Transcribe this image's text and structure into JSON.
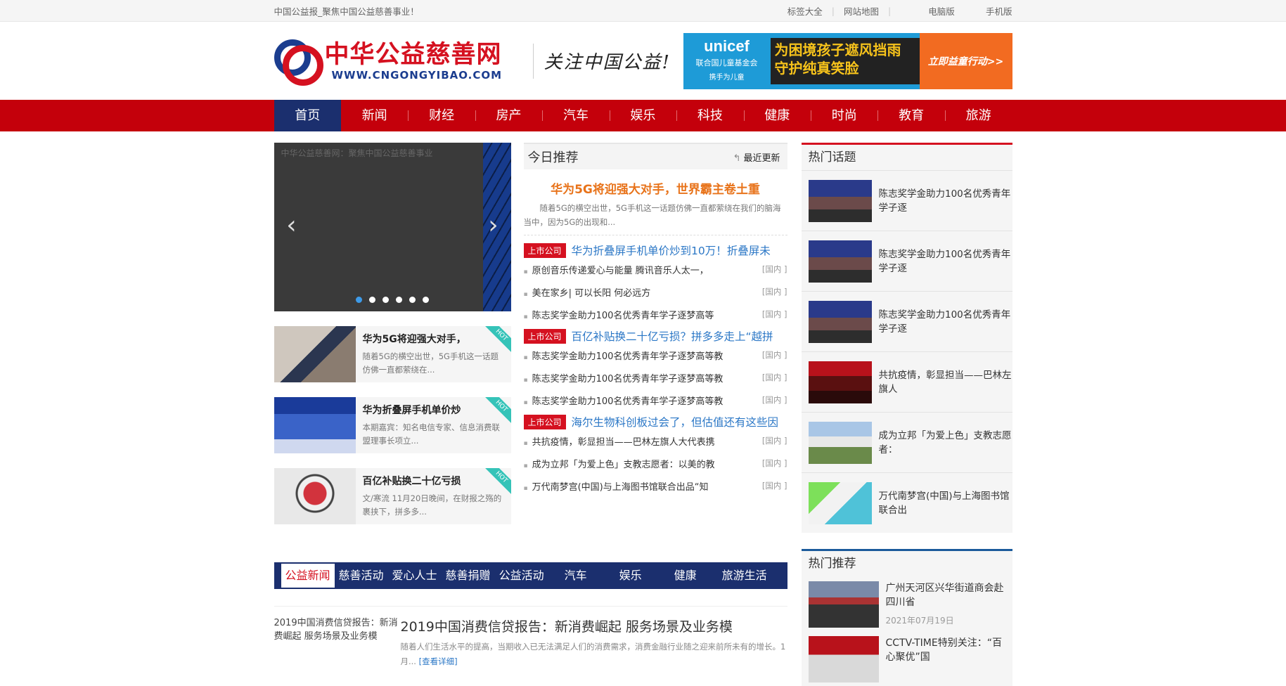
{
  "topbar": {
    "tagline": "中国公益报_聚焦中国公益慈善事业！",
    "links": [
      "标签大全",
      "网站地图",
      "电脑版",
      "手机版"
    ]
  },
  "header": {
    "logo_cn": "中华公益慈善网",
    "logo_en": "WWW.CNGONGYIBAO.COM",
    "slogan": "关注中国公益!",
    "banner": {
      "brand": "unicef",
      "org": "联合国儿童基金会",
      "motto": "携手为儿童",
      "line1": "为困境孩子遮风挡雨",
      "line2": "守护纯真笑脸",
      "cta": "立即益童行动>>"
    }
  },
  "nav": [
    "首页",
    "新闻",
    "财经",
    "房产",
    "汽车",
    "娱乐",
    "科技",
    "健康",
    "时尚",
    "教育",
    "旅游"
  ],
  "slider": {
    "alt_text": "中华公益慈善网：聚焦中国公益慈善事业",
    "dots": 6,
    "active_dot": 0
  },
  "hot_cards": [
    {
      "title": "华为5G将迎强大对手，",
      "desc": "随着5G的横空出世，5G手机这一话题仿佛一直都萦绕在...",
      "badge": "HOT"
    },
    {
      "title": "华为折叠屏手机单价炒",
      "desc": "本期嘉宾：知名电信专家、信息消费联盟理事长项立...",
      "badge": "HOT"
    },
    {
      "title": "百亿补贴换二十亿亏损",
      "desc": "文/寒流 11月20日晚间，在财报之殇的裹挟下，拼多多...",
      "badge": "HOT"
    }
  ],
  "today": {
    "title": "今日推荐",
    "more": "最近更新",
    "headline": "华为5G将迎强大对手，世界霸主卷土重",
    "headline_desc": "随着5G的横空出世，5G手机这一话题仿佛一直都萦绕在我们的脑海当中，因为5G的出现和...",
    "groups": [
      {
        "tag": "上市公司",
        "lead": "华为折叠屏手机单价炒到10万！折叠屏未",
        "items": [
          {
            "title": "原创音乐传递爱心与能量 腾讯音乐人太一，",
            "cat": "[国内 ]"
          },
          {
            "title": "美在家乡| 可以长阳 何必远方",
            "cat": "[国内 ]"
          },
          {
            "title": "陈志奖学金助力100名优秀青年学子逐梦高等",
            "cat": "[国内 ]"
          }
        ]
      },
      {
        "tag": "上市公司",
        "lead": "百亿补贴换二十亿亏损？拼多多走上“越拼",
        "items": [
          {
            "title": "陈志奖学金助力100名优秀青年学子逐梦高等教",
            "cat": "[国内 ]"
          },
          {
            "title": "陈志奖学金助力100名优秀青年学子逐梦高等教",
            "cat": "[国内 ]"
          },
          {
            "title": "陈志奖学金助力100名优秀青年学子逐梦高等教",
            "cat": "[国内 ]"
          }
        ]
      },
      {
        "tag": "上市公司",
        "lead": "海尔生物科创板过会了，但估值还有这些因",
        "items": [
          {
            "title": "共抗疫情，彰显担当——巴林左旗人大代表携",
            "cat": "[国内 ]"
          },
          {
            "title": "成为立邦「为爱上色」支教志愿者：以美的教",
            "cat": "[国内 ]"
          },
          {
            "title": "万代南梦宫(中国)与上海图书馆联合出品“知",
            "cat": "[国内 ]"
          }
        ]
      }
    ]
  },
  "hot_topics": {
    "title": "热门话题",
    "items": [
      {
        "text": "陈志奖学金助力100名优秀青年学子逐"
      },
      {
        "text": "陈志奖学金助力100名优秀青年学子逐"
      },
      {
        "text": "陈志奖学金助力100名优秀青年学子逐"
      },
      {
        "text": "共抗疫情，彰显担当——巴林左旗人"
      },
      {
        "text": "成为立邦「为爱上色」支教志愿者："
      },
      {
        "text": "万代南梦宫(中国)与上海图书馆联合出"
      }
    ]
  },
  "hot_rec": {
    "title": "热门推荐",
    "items": [
      {
        "text": "广州天河区兴华街道商会赴四川省",
        "date": "2021年07月19日"
      },
      {
        "text": "CCTV-TIME特别关注：“百心聚优”国",
        "date": ""
      }
    ]
  },
  "tabs": [
    "公益新闻",
    "慈善活动",
    "爱心人士",
    "慈善捐赠",
    "公益活动",
    "汽车",
    "娱乐",
    "健康",
    "旅游生活"
  ],
  "article": {
    "img_alt": "2019中国消费信贷报告：新消费崛起 服务场景及业务模",
    "title": "2019中国消费信贷报告：新消费崛起 服务场景及业务模",
    "desc": "随着人们生活水平的提高，当期收入已无法满足人们的消费需求，消费金融行业随之迎来前所未有的增长。1月...",
    "more": "[查看详细]"
  },
  "colors": {
    "nav_red": "#c4000b",
    "nav_active": "#1b2f6e",
    "tag_red": "#d51120",
    "link_blue": "#2b77c6",
    "headline_orange": "#e8731a"
  }
}
